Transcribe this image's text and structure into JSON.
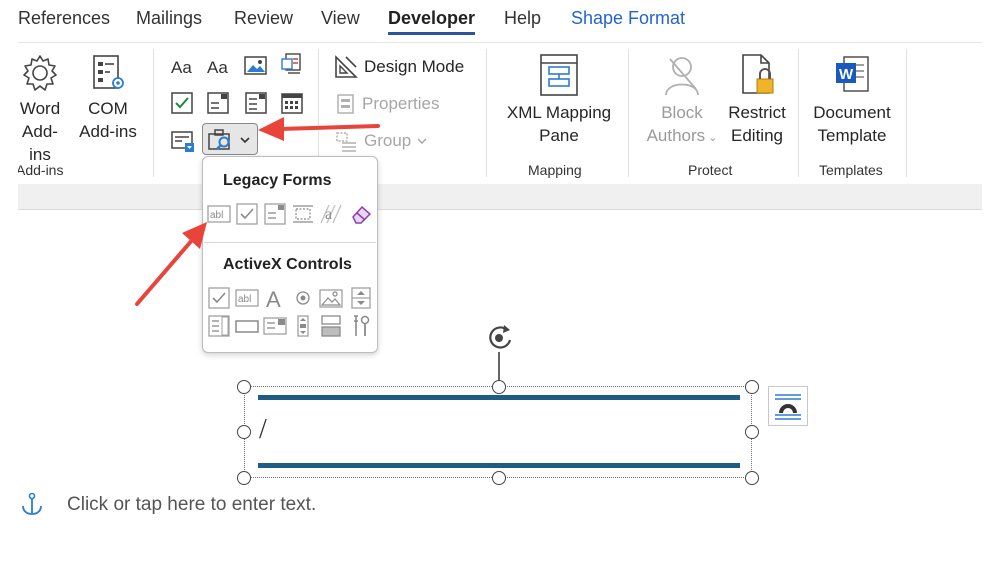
{
  "tabs": [
    "References",
    "Mailings",
    "Review",
    "View",
    "Developer",
    "Help",
    "Shape Format"
  ],
  "active_tab": "Developer",
  "groups": {
    "addins": {
      "label": "Add-ins",
      "word_addins": {
        "line1": "Word",
        "line2": "Add-ins"
      },
      "com_addins": {
        "line1": "COM",
        "line2": "Add-ins"
      }
    },
    "controls": {
      "design_mode": "Design Mode",
      "properties": "Properties",
      "group": "Group"
    },
    "mapping": {
      "label": "Mapping",
      "xml_pane": {
        "line1": "XML Mapping",
        "line2": "Pane"
      }
    },
    "protect": {
      "label": "Protect",
      "block_authors": {
        "line1": "Block",
        "line2": "Authors"
      },
      "restrict_editing": {
        "line1": "Restrict",
        "line2": "Editing"
      }
    },
    "templates": {
      "label": "Templates",
      "document_template": {
        "line1": "Document",
        "line2": "Template"
      }
    }
  },
  "dropdown": {
    "legacy_heading": "Legacy Forms",
    "activex_heading": "ActiveX Controls",
    "legacy_icons": [
      "text-form-field-icon",
      "check-box-form-field-icon",
      "combo-box-form-field-icon",
      "insert-frame-icon",
      "form-field-shading-icon",
      "reset-form-fields-icon"
    ],
    "activex_icons": [
      "check-box-icon",
      "text-box-icon",
      "label-icon",
      "option-button-icon",
      "image-icon",
      "spin-button-icon",
      "list-box-icon",
      "command-button-icon",
      "combo-box-icon",
      "scroll-bar-icon",
      "toggle-button-icon",
      "more-controls-icon"
    ]
  },
  "document": {
    "placeholder": "Click or tap here to enter text.",
    "caret_char": "/"
  },
  "colors": {
    "accent": "#2b579a",
    "annotation_arrow": "#e8443a",
    "shape_line": "#1f5c85",
    "context_tab": "#2564cf"
  }
}
